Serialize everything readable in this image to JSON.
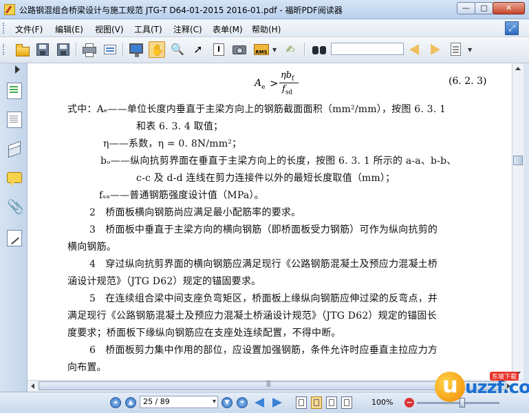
{
  "window": {
    "title": "公路钢混组合桥梁设计与施工规范 JTG-T D64-01-2015 2016-01.pdf - 福昕PDF阅读器",
    "minimize": "—",
    "maximize": "□",
    "close": "✕"
  },
  "menubar": {
    "items": [
      {
        "label": "文件(F)"
      },
      {
        "label": "编辑(E)"
      },
      {
        "label": "视图(V)"
      },
      {
        "label": "工具(T)"
      },
      {
        "label": "注释(C)"
      },
      {
        "label": "表单(M)"
      },
      {
        "label": "帮助(H)"
      }
    ]
  },
  "toolbar": {
    "icons": [
      "open-folder-icon",
      "save-icon",
      "save-as-icon",
      "print-icon",
      "fullscreen-icon",
      "document-properties-icon",
      "hand-tool-icon",
      "zoom-tool-icon",
      "select-arrow-icon",
      "text-select-icon",
      "snapshot-camera-icon",
      "rms-icon",
      "sign-icon",
      "binoculars-icon",
      "previous-result-icon",
      "next-result-icon",
      "typewriter-icon"
    ],
    "rms_label": "RMS",
    "search_value": ""
  },
  "document": {
    "formula": {
      "lhs": "A",
      "lhs_sub": "e",
      "relation": ">",
      "numerator": "ηb",
      "numerator_sub": "f",
      "denominator": "f",
      "denominator_sub": "sd",
      "equation_number": "(6. 2. 3)"
    },
    "lines": [
      "式中：Aₑ——单位长度内垂直于主梁方向上的钢筋截面面积（mm²/mm），按图 6. 3. 1",
      "和表 6. 3. 4 取值；",
      "η——系数，η = 0. 8N/mm²；",
      "bₒ——纵向抗剪界面在垂直于主梁方向上的长度，按图 6. 3. 1 所示的 a-a、b-b、",
      "c-c 及 d-d 连线在剪力连接件以外的最短长度取值（mm）；",
      "fₛₐ——普通钢筋强度设计值（MPa）。",
      "2　桥面板横向钢筋尚应满足最小配筋率的要求。",
      "3　桥面板中垂直于主梁方向的横向钢筋（即桥面板受力钢筋）可作为纵向抗剪的",
      "横向钢筋。",
      "4　穿过纵向抗剪界面的横向钢筋应满足现行《公路钢筋混凝土及预应力混凝土桥",
      "涵设计规范》（JTG D62）规定的锚固要求。",
      "5　在连续组合梁中间支座负弯矩区，桥面板上缘纵向钢筋应伸过梁的反弯点，并",
      "满足现行《公路钢筋混凝土及预应力混凝土桥涵设计规范》（JTG D62）规定的锚固长",
      "度要求；桥面板下缘纵向钢筋应在支座处连续配置，不得中断。",
      "6　桥面板剪力集中作用的部位，应设置加强钢筋，条件允许时应垂直主拉应力方",
      "向布置。"
    ]
  },
  "statusbar": {
    "page_display": "25 / 89",
    "zoom": "100%",
    "zoom_level_percent": 100,
    "zoom_minus": "−"
  },
  "watermark": {
    "text": "uzzf.com",
    "badge": "东坡下载"
  }
}
